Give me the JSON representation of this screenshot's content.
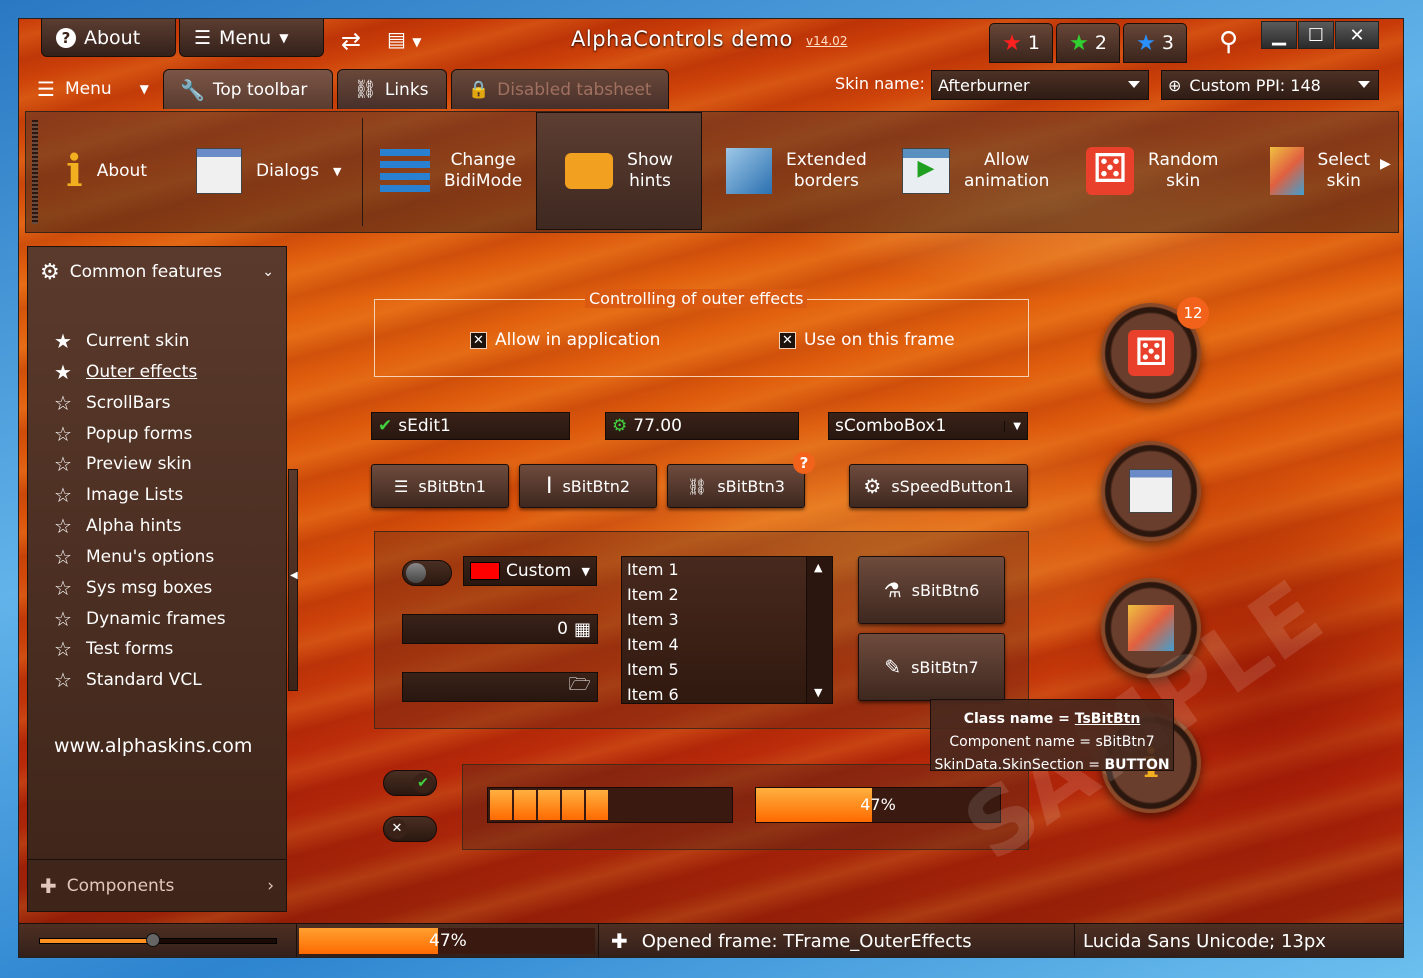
{
  "title_bar": {
    "about_label": "About",
    "menu_label": "Menu",
    "caption": "AlphaControls demo",
    "version": "v14.02",
    "star_tabs": [
      "1",
      "2",
      "3"
    ]
  },
  "tabs": {
    "menu_label": "Menu",
    "items": [
      "Top toolbar",
      "Links",
      "Disabled tabsheet"
    ]
  },
  "skin": {
    "label": "Skin name:",
    "value": "Afterburner",
    "ppi": "Custom PPI: 148"
  },
  "toolbar": {
    "items": [
      "About",
      "Dialogs",
      "Change\nBidiMode",
      "Show\nhints",
      "Extended\nborders",
      "Allow\nanimation",
      "Random\nskin",
      "Select\nskin"
    ]
  },
  "sidebar": {
    "header": "Common features",
    "items": [
      "Current skin",
      "Outer effects",
      "ScrollBars",
      "Popup forms",
      "Preview skin",
      "Image Lists",
      "Alpha hints",
      "Menu's options",
      "Sys msg boxes",
      "Dynamic frames",
      "Test forms",
      "Standard VCL"
    ],
    "url": "www.alphaskins.com",
    "footer": "Components"
  },
  "main": {
    "group_title": "Controlling of outer effects",
    "check1": "Allow in application",
    "check2": "Use on this frame",
    "edit1": "sEdit1",
    "edit2": "77.00",
    "combo1": "sComboBox1",
    "btn1": "sBitBtn1",
    "btn2": "sBitBtn2",
    "btn3": "sBitBtn3",
    "speed": "sSpeedButton1",
    "color_combo": "Custom",
    "calc_value": "0",
    "list_items": [
      "Item 1",
      "Item 2",
      "Item 3",
      "Item 4",
      "Item 5",
      "Item 6"
    ],
    "btn6": "sBitBtn6",
    "btn7": "sBitBtn7",
    "progress_percent": 47,
    "progress_label": "47%",
    "badge": "12"
  },
  "hint": {
    "line1_label": "Class name = ",
    "line1_value": "TsBitBtn",
    "line2": "Component name = sBitBtn7",
    "line3_label": "SkinData.SkinSection = ",
    "line3_value": "BUTTON"
  },
  "watermark": "SAMPLE",
  "status": {
    "progress_label": "47%",
    "frame": "Opened frame: TFrame_OuterEffects",
    "font": "Lucida Sans Unicode; 13px"
  },
  "colors": {
    "accent": "#f2621a",
    "progress": "#ff7a10",
    "panel_dark": "#3e2419"
  }
}
